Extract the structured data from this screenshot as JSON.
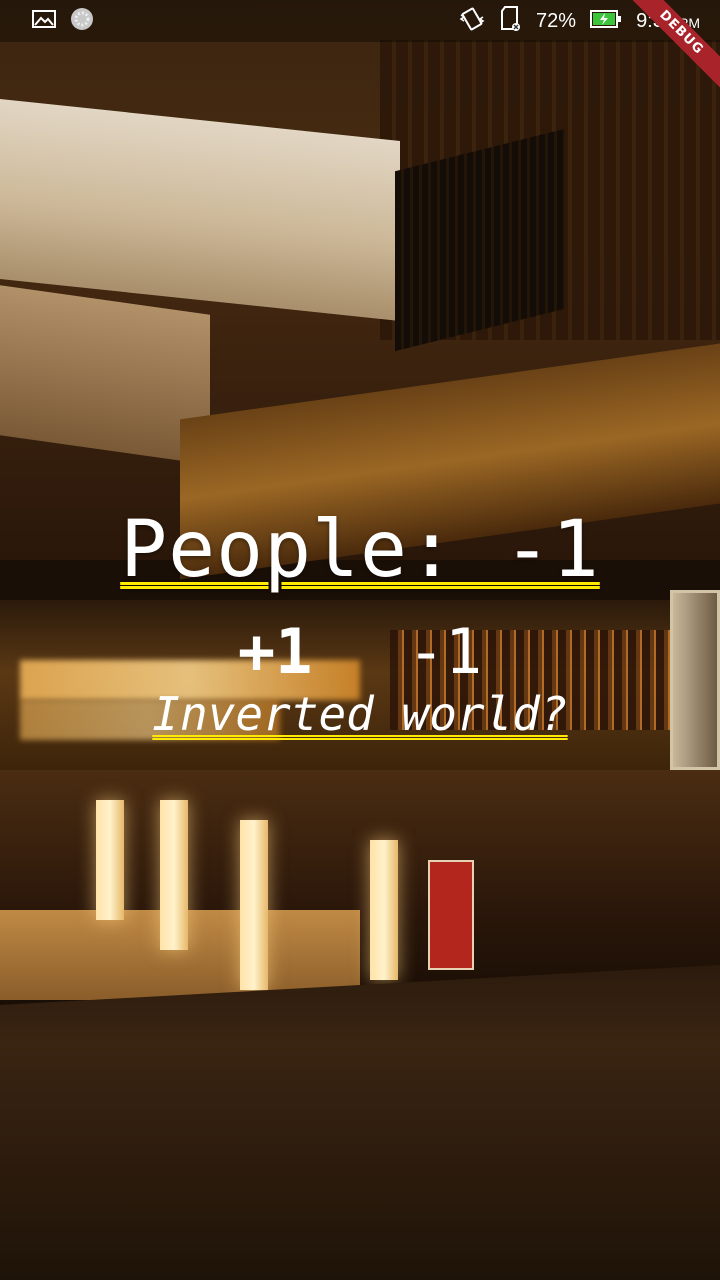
{
  "status_bar": {
    "battery_percent": "72%",
    "time": "9:31",
    "ampm": "PM",
    "debug_label": "DEBUG",
    "icons": [
      "image-icon",
      "loading-spinner-icon",
      "vibrate-icon",
      "sd-card-icon",
      "battery-charging-icon"
    ]
  },
  "main": {
    "counter_label": "People: -1",
    "increment_label": "+1",
    "decrement_label": "-1",
    "message": "Inverted world?"
  },
  "colors": {
    "underline": "#ffea00",
    "debug_banner": "#a8232a",
    "text": "#ffffff"
  }
}
